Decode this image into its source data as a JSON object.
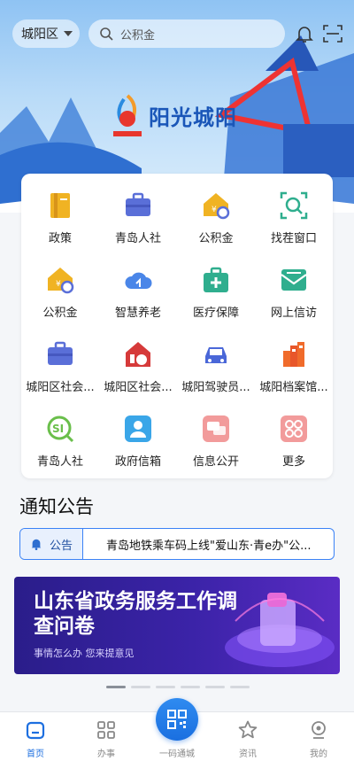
{
  "topbar": {
    "district": "城阳区",
    "search_placeholder": "公积金"
  },
  "logo": {
    "text": "阳光城阳",
    "seal_text": "阳光城阳"
  },
  "services": [
    {
      "label": "政策",
      "icon": "policy-book-icon"
    },
    {
      "label": "青岛人社",
      "icon": "briefcase-icon"
    },
    {
      "label": "公积金",
      "icon": "house-fund-icon"
    },
    {
      "label": "找茬窗口",
      "icon": "magnifier-scan-icon"
    },
    {
      "label": "公积金",
      "icon": "house-fund-icon"
    },
    {
      "label": "智慧养老",
      "icon": "cloud-icon"
    },
    {
      "label": "医疗保障",
      "icon": "medical-kit-icon"
    },
    {
      "label": "网上信访",
      "icon": "mail-icon"
    },
    {
      "label": "城阳区社会...",
      "icon": "briefcase-icon"
    },
    {
      "label": "城阳区社会...",
      "icon": "home-badge-icon"
    },
    {
      "label": "城阳驾驶员...",
      "icon": "car-icon"
    },
    {
      "label": "城阳档案馆...",
      "icon": "archive-building-icon"
    },
    {
      "label": "青岛人社",
      "icon": "si-search-icon"
    },
    {
      "label": "政府信箱",
      "icon": "person-card-icon"
    },
    {
      "label": "信息公开",
      "icon": "chat-bubble-icon"
    },
    {
      "label": "更多",
      "icon": "more-grid-icon"
    }
  ],
  "notice": {
    "title": "通知公告",
    "tag": "公告",
    "text": "青岛地铁乘车码上线\"爱山东·青e办\"公..."
  },
  "banner": {
    "title": "山东省政务服务工作调查问卷",
    "subtitle": "事情怎么办 您来提意见"
  },
  "tabs": [
    {
      "label": "首页",
      "icon": "home-icon",
      "active": true
    },
    {
      "label": "办事",
      "icon": "grid-icon",
      "active": false
    },
    {
      "label": "一码通城",
      "icon": "qr-code-icon",
      "active": false
    },
    {
      "label": "资讯",
      "icon": "star-icon",
      "active": false
    },
    {
      "label": "我的",
      "icon": "profile-icon",
      "active": false
    }
  ],
  "colors": {
    "primary": "#1d6fe0",
    "notice_border": "#3b82f6",
    "banner_bg": "#3b23a8"
  }
}
